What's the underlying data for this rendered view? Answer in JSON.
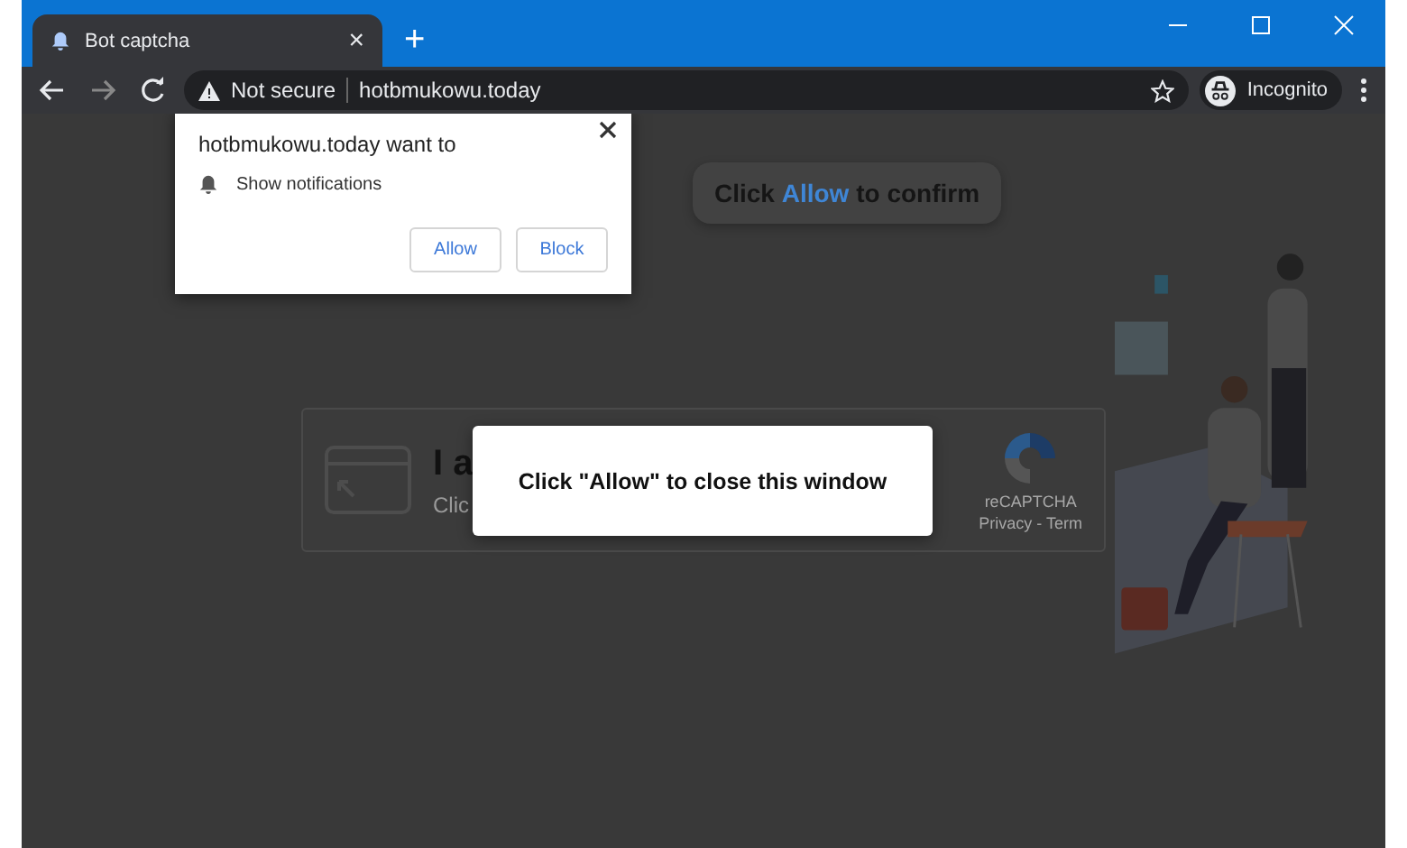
{
  "window": {
    "tab": {
      "title": "Bot captcha",
      "close": "×"
    },
    "new_tab": "+"
  },
  "toolbar": {
    "security": "Not secure",
    "url": "hotbmukowu.today",
    "profile": "Incognito"
  },
  "permission_prompt": {
    "title": "hotbmukowu.today want to",
    "item": "Show notifications",
    "buttons": [
      "Allow",
      "Block"
    ]
  },
  "page": {
    "banner": "Click **Allow** to confirm",
    "captcha": {
      "heading": "I a",
      "subtext": "Clic",
      "brand": "reCAPTCHA",
      "links": "Privacy - Term"
    },
    "modal": "Click \"Allow\" to close this window"
  }
}
